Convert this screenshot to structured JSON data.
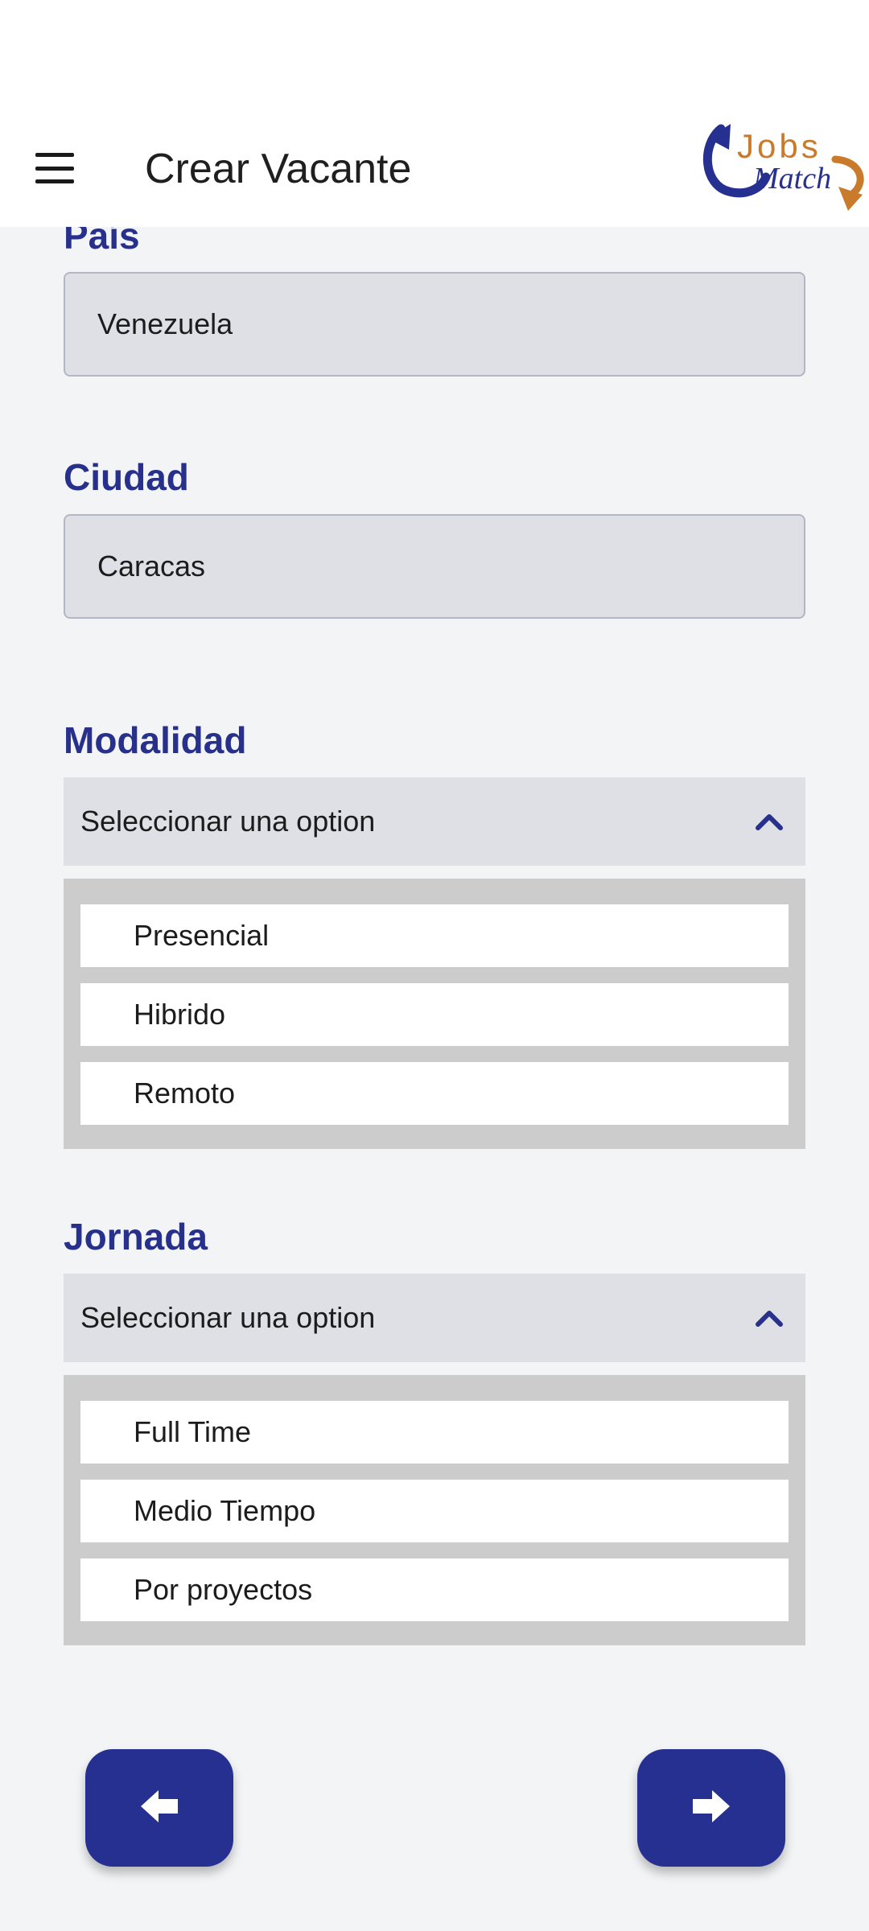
{
  "appbar": {
    "title": "Crear Vacante",
    "logo_text_top": "Jobs",
    "logo_text_bottom": "Match"
  },
  "form": {
    "pais": {
      "label": "País",
      "value": "Venezuela"
    },
    "ciudad": {
      "label": "Ciudad",
      "value": "Caracas"
    },
    "modalidad": {
      "label": "Modalidad",
      "placeholder": "Seleccionar una option",
      "options": [
        "Presencial",
        "Hibrido",
        "Remoto"
      ]
    },
    "jornada": {
      "label": "Jornada",
      "placeholder": "Seleccionar una option",
      "options": [
        "Full Time",
        "Medio Tiempo",
        "Por proyectos"
      ]
    }
  },
  "icons": {
    "menu": "menu-icon",
    "chevron": "chevron-up-icon",
    "back": "arrow-left-icon",
    "next": "arrow-right-icon"
  },
  "colors": {
    "accent": "#263090",
    "label": "#27308a",
    "logo_orange": "#c97a2b"
  }
}
